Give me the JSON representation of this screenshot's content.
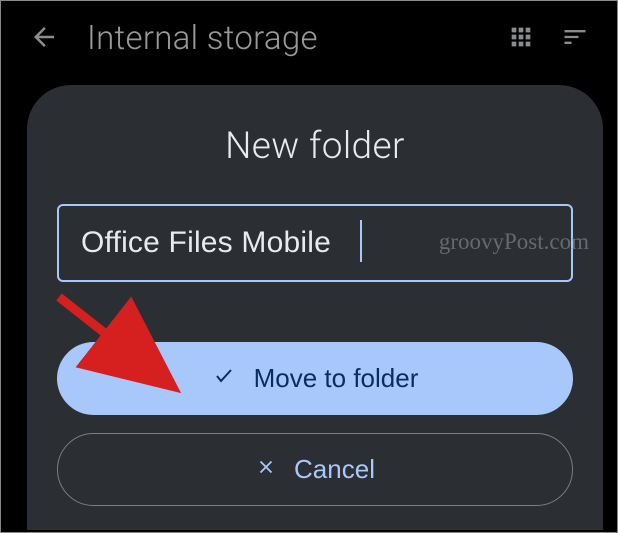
{
  "header": {
    "title": "Internal storage"
  },
  "dialog": {
    "title": "New folder",
    "input_value": "Office Files Mobile",
    "move_label": "Move to folder",
    "cancel_label": "Cancel"
  },
  "watermark": "groovyPost.com"
}
